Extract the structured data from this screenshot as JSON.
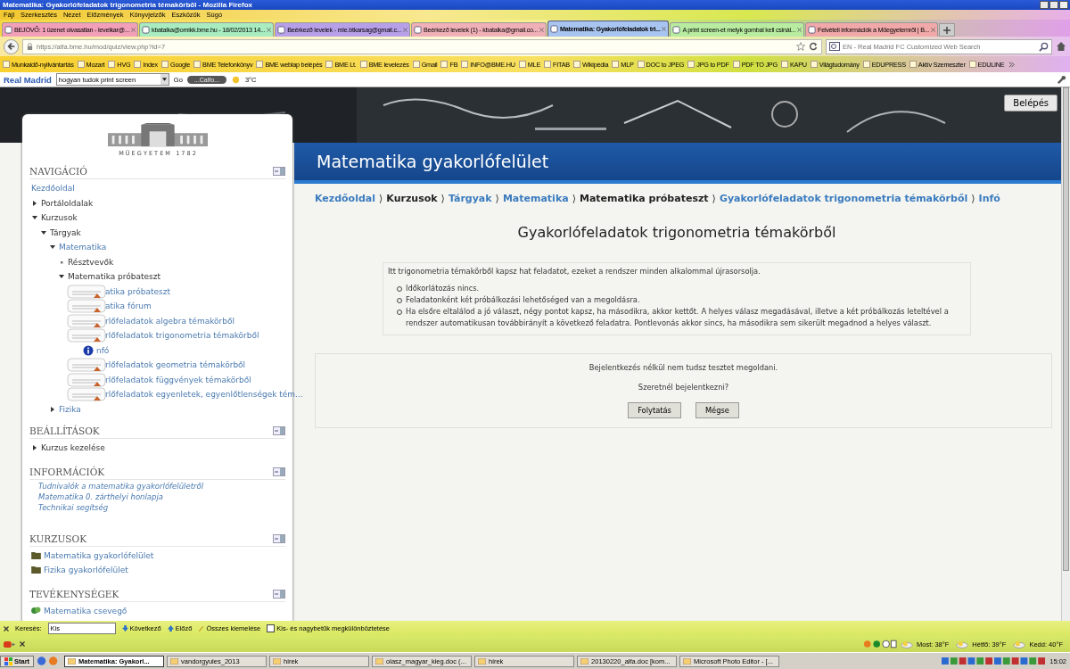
{
  "window": {
    "title": "Matematika: Gyakorlófeladatok trigonometria témakörből - Mozilla Firefox"
  },
  "menu": [
    "Fájl",
    "Szerkesztés",
    "Nézet",
    "Előzmények",
    "Könyvjelzők",
    "Eszközök",
    "Súgó"
  ],
  "tabs": [
    {
      "label": "BEJÖVŐ: 1 üzenet olvasatlan - levelkar@...",
      "selected": false,
      "color": "#f2a0b8"
    },
    {
      "label": "kbatalka@omikk.bme.hu - 18/02/2013 14...",
      "selected": false,
      "color": "#a8ecc0"
    },
    {
      "label": "Beérkező levelek - mle.btkarsag@gmail.c...",
      "selected": false,
      "color": "#b8a0e8"
    },
    {
      "label": "Beérkező levelek (1) - kbatalka@gmail.co...",
      "selected": false,
      "color": "#f0b0b8"
    },
    {
      "label": "Matematika: Gyakorlófeladatok tri...",
      "selected": true,
      "color": "#a8c4f0"
    },
    {
      "label": "A print screen-et melyk gombal kell csinál...",
      "selected": false,
      "color": "#b8eca0"
    },
    {
      "label": "Felvételi információk a Műegyetemről | B...",
      "selected": false,
      "color": "#f0a8a8"
    }
  ],
  "address": {
    "url": "https://alfa.bme.hu/mod/quiz/view.php?id=7",
    "search_placeholder": "EN - Real Madrid FC Customized Web Search"
  },
  "bookmarks": [
    "Munkaidő-nyilvántartás",
    "Mozart",
    "HVG",
    "Index",
    "Google",
    "BME Telefonkönyv",
    "BME weblap belépés",
    "BME Lt.",
    "BME levelezés",
    "Gmail",
    "FB",
    "INFO@BME.HU",
    "MLE",
    "FITAB",
    "Wikipédia",
    "MLP",
    "DOC to JPEG",
    "JPG to PDF",
    "PDF TO JPG",
    "KAPU",
    "Világtudomány",
    "EDUPRESS",
    "Aktív Szemeszter",
    "EDULINE"
  ],
  "addon_toolbar": {
    "brand": "Real Madrid",
    "search_value": "hogyan tudok print screen",
    "go": "Go",
    "player": "...Calfo...",
    "weather": "3°C"
  },
  "login_button": "Belépés",
  "logo_caption": "M Ű E G Y E T E M   1 7 8 2",
  "navigation": {
    "title": "NAVIGÁCIÓ",
    "items": [
      {
        "label": "Kezdőoldal",
        "link": true,
        "kind": "plain"
      },
      {
        "label": "Portáloldalak",
        "link": false,
        "kind": "branch",
        "expanded": false
      },
      {
        "label": "Kurzusok",
        "link": false,
        "kind": "branch",
        "expanded": true,
        "children": [
          {
            "label": "Tárgyak",
            "link": false,
            "kind": "branch",
            "expanded": true,
            "children": [
              {
                "label": "Matematika",
                "link": true,
                "kind": "branch",
                "expanded": true,
                "children": [
                  {
                    "label": "Résztvevők",
                    "link": false,
                    "kind": "leaf"
                  },
                  {
                    "label": "Matematika próbateszt",
                    "link": false,
                    "kind": "branch",
                    "expanded": true,
                    "children": [
                      {
                        "label": "atika próbateszt",
                        "link": true,
                        "kind": "activity"
                      },
                      {
                        "label": "atika fórum",
                        "link": true,
                        "kind": "activity"
                      },
                      {
                        "label": "rlőfeladatok algebra témakörből",
                        "link": true,
                        "kind": "activity"
                      },
                      {
                        "label": "rlőfeladatok trigonometria témakörből",
                        "link": true,
                        "kind": "activity",
                        "children": [
                          {
                            "label": "nfó",
                            "link": true,
                            "kind": "info"
                          }
                        ]
                      },
                      {
                        "label": "rlőfeladatok geometria témakörből",
                        "link": true,
                        "kind": "activity"
                      },
                      {
                        "label": "rlőfeladatok függvények témakörből",
                        "link": true,
                        "kind": "activity"
                      },
                      {
                        "label": "rlőfeladatok egyenletek, egyenlőtlenségek tém...",
                        "link": true,
                        "kind": "activity"
                      }
                    ]
                  }
                ]
              },
              {
                "label": "Fizika",
                "link": true,
                "kind": "branch",
                "expanded": false
              }
            ]
          }
        ]
      }
    ]
  },
  "settings": {
    "title": "BEÁLLÍTÁSOK",
    "items": [
      {
        "label": "Kurzus kezelése",
        "expanded": false
      }
    ]
  },
  "information": {
    "title": "INFORMÁCIÓK",
    "links": [
      "Tudnivalók a matematika gyakorlófelületről",
      "Matematika 0. zárthelyi honlapja",
      "Technikai segítség"
    ]
  },
  "courses": {
    "title": "KURZUSOK",
    "items": [
      "Matematika gyakorlófelület",
      "Fizika gyakorlófelület"
    ]
  },
  "activities": {
    "title": "TEVÉKENYSÉGEK",
    "items": [
      "Matematika csevegő"
    ]
  },
  "site_title": "Matematika gyakorlófelület",
  "breadcrumb": [
    {
      "label": "Kezdőoldal",
      "link": true
    },
    {
      "label": "Kurzusok",
      "link": false
    },
    {
      "label": "Tárgyak",
      "link": true
    },
    {
      "label": "Matematika",
      "link": true
    },
    {
      "label": "Matematika próbateszt",
      "link": false
    },
    {
      "label": "Gyakorlófeladatok trigonometria témakörből",
      "link": true
    },
    {
      "label": "Infó",
      "link": true
    }
  ],
  "breadcrumb_separator": "⟩",
  "heading": "Gyakorlófeladatok trigonometria témakörből",
  "intro": {
    "text": "Itt trigonometria témakörből kapsz hat feladatot, ezeket a rendszer minden alkalommal újrasorsolja.",
    "bullets": [
      "Időkorlátozás nincs.",
      "Feladatonként két próbálkozási lehetőséged van a megoldásra.",
      "Ha elsőre eltalálod a jó választ, négy pontot kapsz, ha másodikra, akkor kettőt. A helyes válasz megadásával, illetve a két próbálkozás leteltével a rendszer automatikusan továbbirányít a következő feladatra. Pontlevonás akkor sincs, ha másodikra sem sikerült megadnod a helyes választ."
    ]
  },
  "login_notice": {
    "message": "Bejelentkezés nélkül nem tudsz tesztet megoldani.",
    "question": "Szeretnél bejelentkezni?",
    "buttons": [
      "Folytatás",
      "Mégse"
    ]
  },
  "find_bar": {
    "label": "Keresés:",
    "value": "Kis",
    "next": "Következő",
    "previous": "Előző",
    "highlight_all": "Összes kiemelése",
    "match_case": {
      "label": "Kis- és nagybetűk megkülönböztetése",
      "checked": false
    }
  },
  "status_bar": {
    "weather": [
      "Most: 38°F",
      "Hétfő: 39°F",
      "Kedd: 40°F"
    ]
  },
  "taskbar": {
    "start": "Start",
    "items": [
      {
        "label": "Matematika: Gyakorl...",
        "selected": true
      },
      {
        "label": "vandorgyules_2013",
        "selected": false
      },
      {
        "label": "hirek",
        "selected": false
      },
      {
        "label": "olasz_magyar_kieg.doc (...",
        "selected": false
      },
      {
        "label": "hirek",
        "selected": false
      },
      {
        "label": "20130220_alfa.doc [kom...",
        "selected": false
      },
      {
        "label": "Microsoft Photo Editor - [...",
        "selected": false
      }
    ],
    "clock": "15:02"
  }
}
